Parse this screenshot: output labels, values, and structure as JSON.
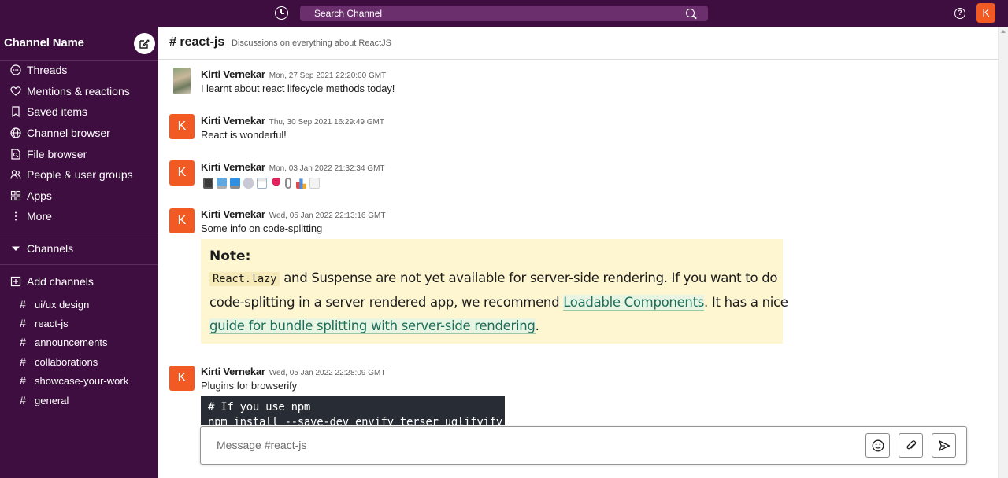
{
  "topbar": {
    "search_label": "Search Channel",
    "user_initial": "K",
    "accent_color": "#f15a22",
    "bg_color": "#3f0e40"
  },
  "sidebar": {
    "workspace_name": "Channel Name",
    "nav_items": [
      {
        "label": "Threads",
        "icon": "threads-icon"
      },
      {
        "label": "Mentions & reactions",
        "icon": "heart-icon"
      },
      {
        "label": "Saved items",
        "icon": "bookmark-icon"
      },
      {
        "label": "Channel browser",
        "icon": "globe-icon"
      },
      {
        "label": "File browser",
        "icon": "file-search-icon"
      },
      {
        "label": "People & user groups",
        "icon": "people-icon"
      },
      {
        "label": "Apps",
        "icon": "apps-grid-icon"
      },
      {
        "label": "More",
        "icon": "more-vertical-icon"
      }
    ],
    "channels_section_label": "Channels",
    "add_channels_label": "Add channels",
    "channels": [
      "ui/ux design",
      "react-js",
      "announcements",
      "collaborations",
      "showcase-your-work",
      "general"
    ]
  },
  "channel": {
    "name": "# react-js",
    "description": "Discussions on everything about ReactJS"
  },
  "messages": [
    {
      "author": "Kirti Vernekar",
      "time": "Mon, 27 Sep 2021 22:20:00 GMT",
      "text": "I learnt about react lifecycle methods today!",
      "avatar": "photo"
    },
    {
      "author": "Kirti Vernekar",
      "time": "Thu, 30 Sep 2021 16:29:49 GMT",
      "text": "React is wonderful!",
      "avatar": "K"
    },
    {
      "author": "Kirti Vernekar",
      "time": "Mon, 03 Jan 2022 21:32:34 GMT",
      "text": "",
      "avatar": "K",
      "emojis": [
        "phone-icon",
        "laptop-icon",
        "desktop-icon",
        "mouse-icon",
        "calendar-icon",
        "pushpin-icon",
        "paperclip-icon",
        "bar-chart-icon",
        "trend-up-icon"
      ]
    },
    {
      "author": "Kirti Vernekar",
      "time": "Wed, 05 Jan 2022 22:13:16 GMT",
      "text": "Some info on code-splitting",
      "avatar": "K"
    },
    {
      "author": "Kirti Vernekar",
      "time": "Wed, 05 Jan 2022 22:28:09 GMT",
      "text": "Plugins for browserify",
      "avatar": "K"
    }
  ],
  "note": {
    "title": "Note:",
    "code": "React.lazy",
    "line1_rest": " and Suspense are not yet available for server-side rendering. If you want to do",
    "line2_start": "code-splitting in a server rendered app, we recommend ",
    "link1": "Loadable Components",
    "line2_end": ". It has a nice",
    "link2": "guide for bundle splitting with server-side rendering",
    "line3_end": "."
  },
  "code_block": {
    "lines": [
      "# If you use npm",
      "npm install --save-dev envify terser uglifyify"
    ]
  },
  "composer": {
    "placeholder": "Message #react-js"
  }
}
